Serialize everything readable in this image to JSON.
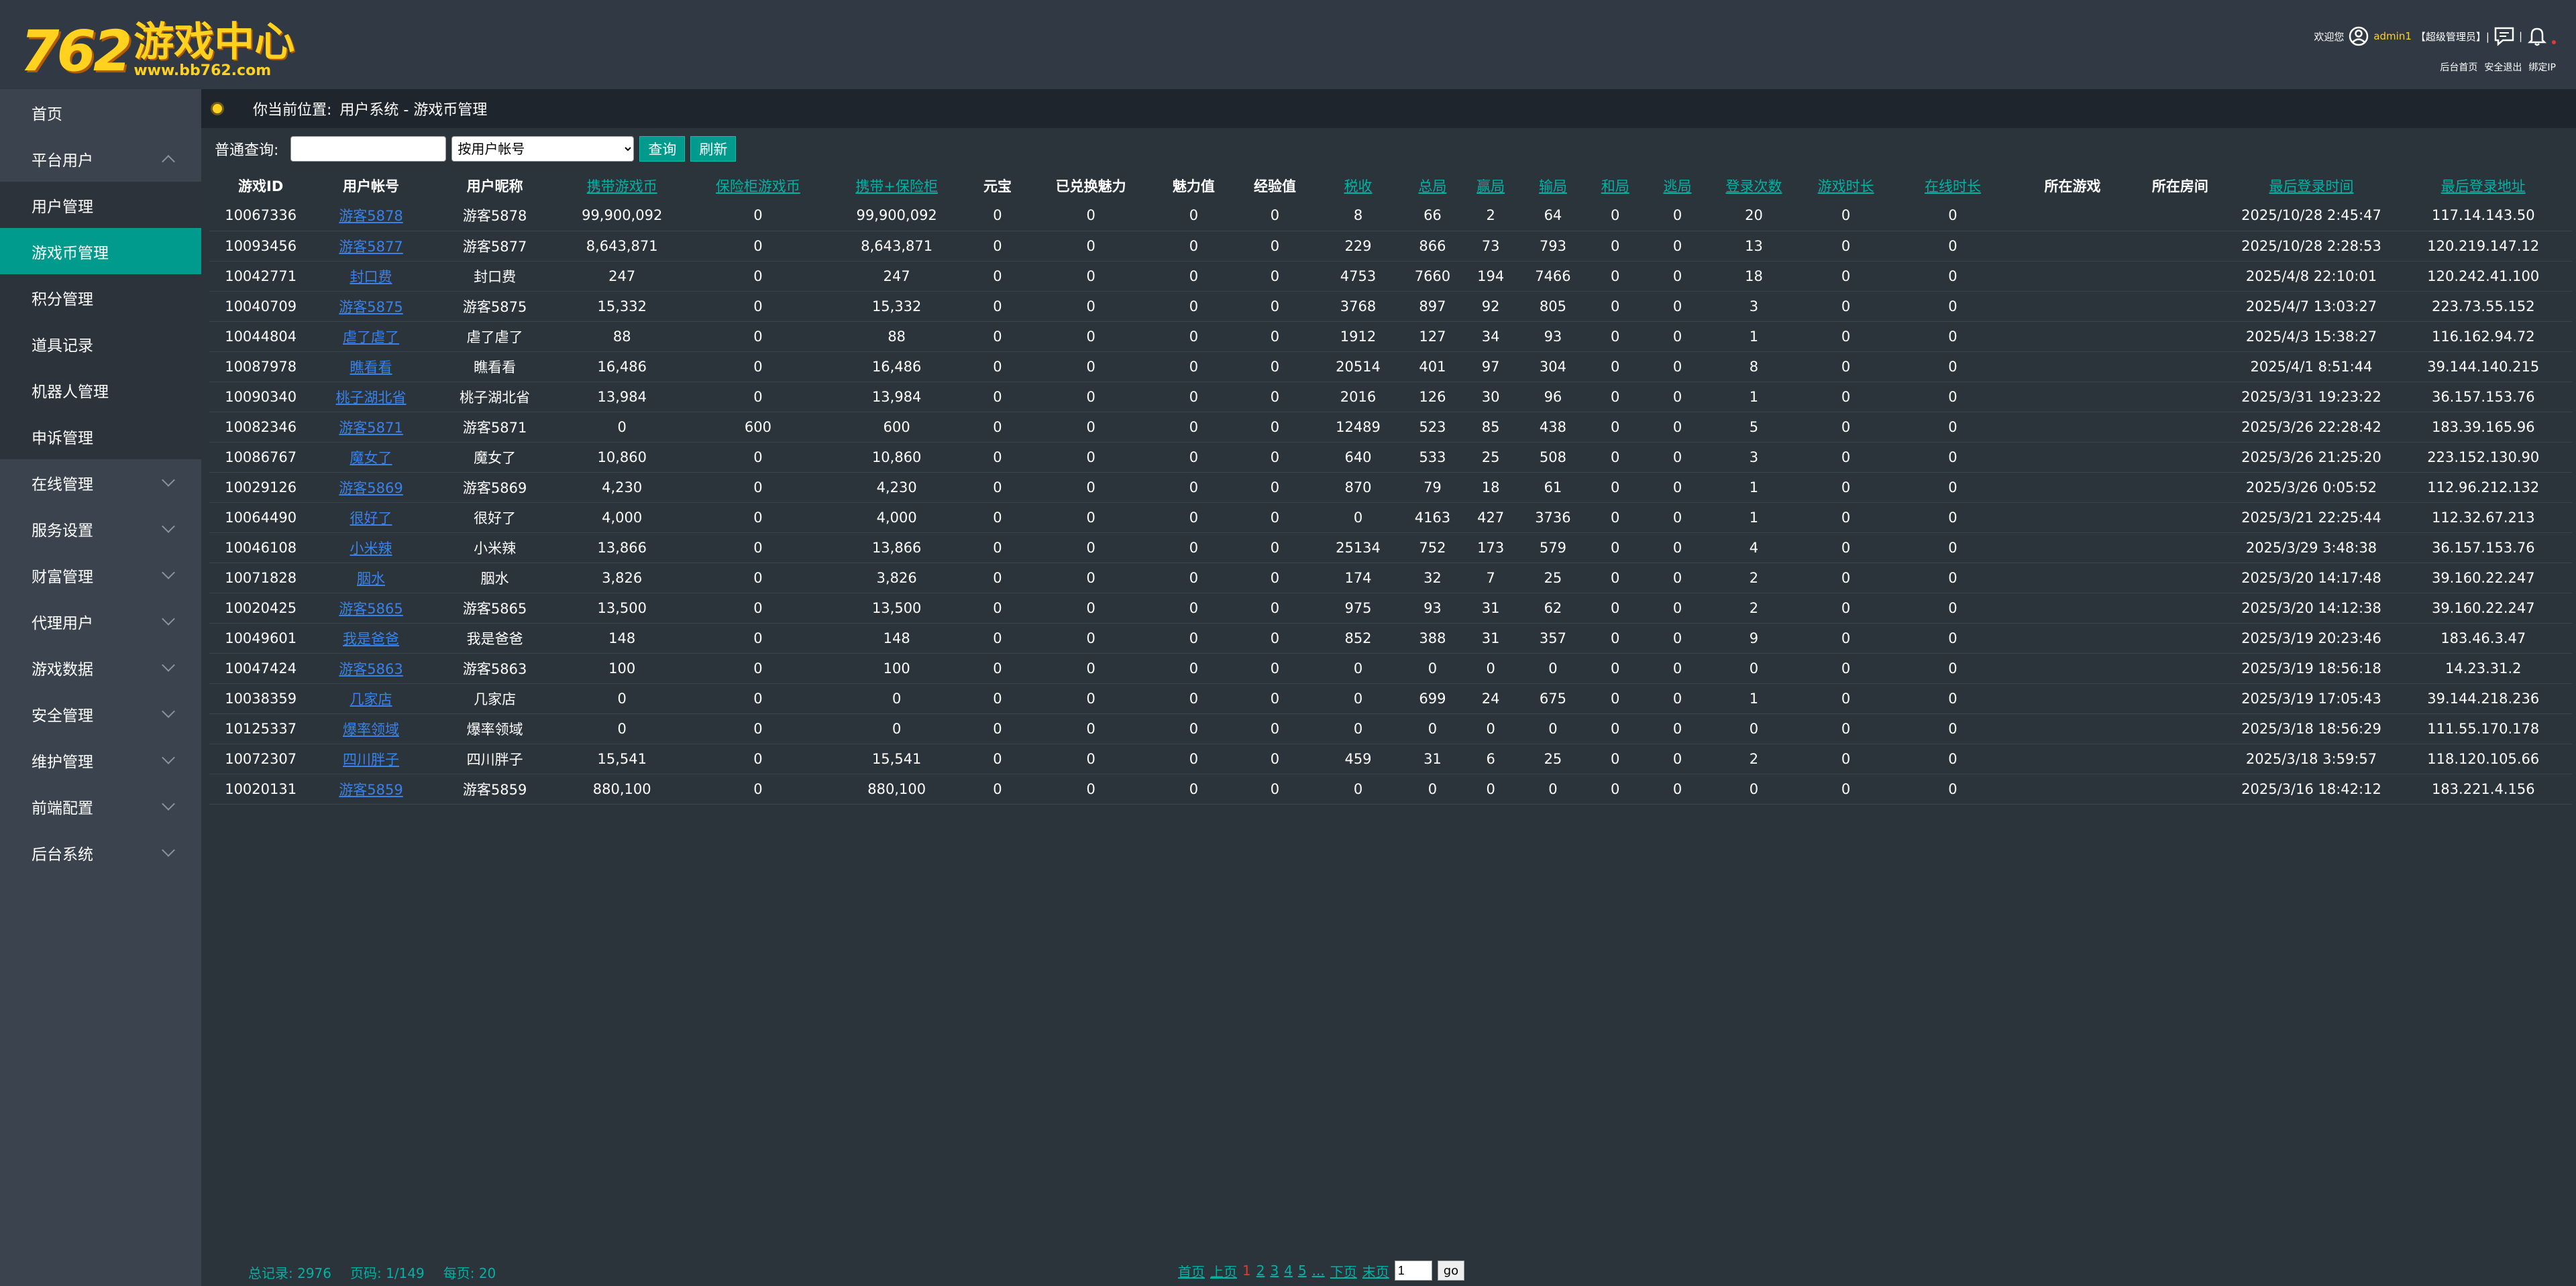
{
  "header": {
    "logo_number": "762",
    "logo_title": "游戏中心",
    "logo_url": "www.bb762.com",
    "welcome": "欢迎您",
    "username": "admin1",
    "role": "【超级管理员】|",
    "sep": "|",
    "links": [
      "后台首页",
      "安全退出",
      "绑定IP"
    ]
  },
  "sidebar": {
    "items": [
      {
        "label": "首页"
      },
      {
        "label": "平台用户",
        "expanded": true
      },
      {
        "label": "在线管理"
      },
      {
        "label": "服务设置"
      },
      {
        "label": "财富管理"
      },
      {
        "label": "代理用户"
      },
      {
        "label": "游戏数据"
      },
      {
        "label": "安全管理"
      },
      {
        "label": "维护管理"
      },
      {
        "label": "前端配置"
      },
      {
        "label": "后台系统"
      }
    ],
    "subitems": [
      "用户管理",
      "游戏币管理",
      "积分管理",
      "道具记录",
      "机器人管理",
      "申诉管理"
    ],
    "active_sub": "游戏币管理"
  },
  "breadcrumb": {
    "prefix": "你当前位置:",
    "path": "用户系统 - 游戏币管理"
  },
  "search": {
    "label": "普通查询:",
    "input_value": "",
    "select_value": "按用户帐号",
    "query_btn": "查询",
    "refresh_btn": "刷新"
  },
  "table": {
    "columns": [
      "游戏ID",
      "用户帐号",
      "用户昵称",
      "携带游戏币",
      "保险柜游戏币",
      "携带+保险柜",
      "元宝",
      "已兑换魅力",
      "魅力值",
      "经验值",
      "税收",
      "总局",
      "赢局",
      "输局",
      "和局",
      "逃局",
      "登录次数",
      "游戏时长",
      "在线时长",
      "所在游戏",
      "所在房间",
      "最后登录时间",
      "最后登录地址"
    ],
    "rows": [
      [
        "10067336",
        "游客5878",
        "游客5878",
        "99,900,092",
        "0",
        "99,900,092",
        "0",
        "0",
        "0",
        "0",
        "8",
        "66",
        "2",
        "64",
        "0",
        "0",
        "20",
        "0",
        "0",
        "",
        "",
        "2025/10/28 2:45:47",
        "117.14.143.50"
      ],
      [
        "10093456",
        "游客5877",
        "游客5877",
        "8,643,871",
        "0",
        "8,643,871",
        "0",
        "0",
        "0",
        "0",
        "229",
        "866",
        "73",
        "793",
        "0",
        "0",
        "13",
        "0",
        "0",
        "",
        "",
        "2025/10/28 2:28:53",
        "120.219.147.12"
      ],
      [
        "10042771",
        "封口费",
        "封口费",
        "247",
        "0",
        "247",
        "0",
        "0",
        "0",
        "0",
        "4753",
        "7660",
        "194",
        "7466",
        "0",
        "0",
        "18",
        "0",
        "0",
        "",
        "",
        "2025/4/8 22:10:01",
        "120.242.41.100"
      ],
      [
        "10040709",
        "游客5875",
        "游客5875",
        "15,332",
        "0",
        "15,332",
        "0",
        "0",
        "0",
        "0",
        "3768",
        "897",
        "92",
        "805",
        "0",
        "0",
        "3",
        "0",
        "0",
        "",
        "",
        "2025/4/7 13:03:27",
        "223.73.55.152"
      ],
      [
        "10044804",
        "虐了虐了",
        "虐了虐了",
        "88",
        "0",
        "88",
        "0",
        "0",
        "0",
        "0",
        "1912",
        "127",
        "34",
        "93",
        "0",
        "0",
        "1",
        "0",
        "0",
        "",
        "",
        "2025/4/3 15:38:27",
        "116.162.94.72"
      ],
      [
        "10087978",
        "瞧看看",
        "瞧看看",
        "16,486",
        "0",
        "16,486",
        "0",
        "0",
        "0",
        "0",
        "20514",
        "401",
        "97",
        "304",
        "0",
        "0",
        "8",
        "0",
        "0",
        "",
        "",
        "2025/4/1 8:51:44",
        "39.144.140.215"
      ],
      [
        "10090340",
        "桃子湖北省",
        "桃子湖北省",
        "13,984",
        "0",
        "13,984",
        "0",
        "0",
        "0",
        "0",
        "2016",
        "126",
        "30",
        "96",
        "0",
        "0",
        "1",
        "0",
        "0",
        "",
        "",
        "2025/3/31 19:23:22",
        "36.157.153.76"
      ],
      [
        "10082346",
        "游客5871",
        "游客5871",
        "0",
        "600",
        "600",
        "0",
        "0",
        "0",
        "0",
        "12489",
        "523",
        "85",
        "438",
        "0",
        "0",
        "5",
        "0",
        "0",
        "",
        "",
        "2025/3/26 22:28:42",
        "183.39.165.96"
      ],
      [
        "10086767",
        "魔女了",
        "魔女了",
        "10,860",
        "0",
        "10,860",
        "0",
        "0",
        "0",
        "0",
        "640",
        "533",
        "25",
        "508",
        "0",
        "0",
        "3",
        "0",
        "0",
        "",
        "",
        "2025/3/26 21:25:20",
        "223.152.130.90"
      ],
      [
        "10029126",
        "游客5869",
        "游客5869",
        "4,230",
        "0",
        "4,230",
        "0",
        "0",
        "0",
        "0",
        "870",
        "79",
        "18",
        "61",
        "0",
        "0",
        "1",
        "0",
        "0",
        "",
        "",
        "2025/3/26 0:05:52",
        "112.96.212.132"
      ],
      [
        "10064490",
        "很好了",
        "很好了",
        "4,000",
        "0",
        "4,000",
        "0",
        "0",
        "0",
        "0",
        "0",
        "4163",
        "427",
        "3736",
        "0",
        "0",
        "1",
        "0",
        "0",
        "",
        "",
        "2025/3/21 22:25:44",
        "112.32.67.213"
      ],
      [
        "10046108",
        "小米辣",
        "小米辣",
        "13,866",
        "0",
        "13,866",
        "0",
        "0",
        "0",
        "0",
        "25134",
        "752",
        "173",
        "579",
        "0",
        "0",
        "4",
        "0",
        "0",
        "",
        "",
        "2025/3/29 3:48:38",
        "36.157.153.76"
      ],
      [
        "10071828",
        "胭水",
        "胭水",
        "3,826",
        "0",
        "3,826",
        "0",
        "0",
        "0",
        "0",
        "174",
        "32",
        "7",
        "25",
        "0",
        "0",
        "2",
        "0",
        "0",
        "",
        "",
        "2025/3/20 14:17:48",
        "39.160.22.247"
      ],
      [
        "10020425",
        "游客5865",
        "游客5865",
        "13,500",
        "0",
        "13,500",
        "0",
        "0",
        "0",
        "0",
        "975",
        "93",
        "31",
        "62",
        "0",
        "0",
        "2",
        "0",
        "0",
        "",
        "",
        "2025/3/20 14:12:38",
        "39.160.22.247"
      ],
      [
        "10049601",
        "我是爸爸",
        "我是爸爸",
        "148",
        "0",
        "148",
        "0",
        "0",
        "0",
        "0",
        "852",
        "388",
        "31",
        "357",
        "0",
        "0",
        "9",
        "0",
        "0",
        "",
        "",
        "2025/3/19 20:23:46",
        "183.46.3.47"
      ],
      [
        "10047424",
        "游客5863",
        "游客5863",
        "100",
        "0",
        "100",
        "0",
        "0",
        "0",
        "0",
        "0",
        "0",
        "0",
        "0",
        "0",
        "0",
        "0",
        "0",
        "0",
        "",
        "",
        "2025/3/19 18:56:18",
        "14.23.31.2"
      ],
      [
        "10038359",
        "几家店",
        "几家店",
        "0",
        "0",
        "0",
        "0",
        "0",
        "0",
        "0",
        "0",
        "699",
        "24",
        "675",
        "0",
        "0",
        "1",
        "0",
        "0",
        "",
        "",
        "2025/3/19 17:05:43",
        "39.144.218.236"
      ],
      [
        "10125337",
        "爆率领域",
        "爆率领域",
        "0",
        "0",
        "0",
        "0",
        "0",
        "0",
        "0",
        "0",
        "0",
        "0",
        "0",
        "0",
        "0",
        "0",
        "0",
        "0",
        "",
        "",
        "2025/3/18 18:56:29",
        "111.55.170.178"
      ],
      [
        "10072307",
        "四川胖子",
        "四川胖子",
        "15,541",
        "0",
        "15,541",
        "0",
        "0",
        "0",
        "0",
        "459",
        "31",
        "6",
        "25",
        "0",
        "0",
        "2",
        "0",
        "0",
        "",
        "",
        "2025/3/18 3:59:57",
        "118.120.105.66"
      ],
      [
        "10020131",
        "游客5859",
        "游客5859",
        "880,100",
        "0",
        "880,100",
        "0",
        "0",
        "0",
        "0",
        "0",
        "0",
        "0",
        "0",
        "0",
        "0",
        "0",
        "0",
        "0",
        "",
        "",
        "2025/3/16 18:42:12",
        "183.221.4.156"
      ]
    ]
  },
  "footer": {
    "total": "总记录: 2976",
    "page_info": "页码: 1/149",
    "per_page": "每页: 20",
    "pager": {
      "first": "首页",
      "prev": "上页",
      "pages": [
        "1",
        "2",
        "3",
        "4",
        "5"
      ],
      "current": "1",
      "ellipsis": "...",
      "next": "下页",
      "last": "末页",
      "input_value": "1",
      "go": "go"
    }
  }
}
